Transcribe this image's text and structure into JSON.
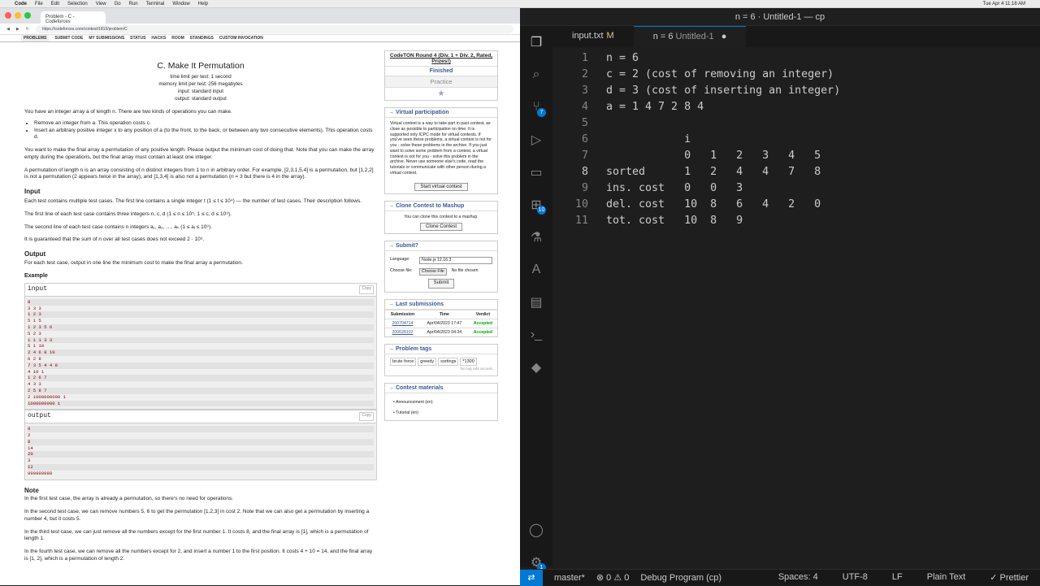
{
  "mac": {
    "app": "Code",
    "menus": [
      "File",
      "Edit",
      "Selection",
      "View",
      "Go",
      "Run",
      "Terminal",
      "Window",
      "Help"
    ],
    "clock": "Tue Apr 4 11:18 AM"
  },
  "browser": {
    "tab": "Problem - C - Codeforces",
    "url": "https://codeforces.com/contest/1810/problem/C",
    "nav": [
      "PROBLEMS",
      "SUBMIT CODE",
      "MY SUBMISSIONS",
      "STATUS",
      "HACKS",
      "ROOM",
      "STANDINGS",
      "CUSTOM INVOCATION"
    ]
  },
  "problem": {
    "title": "C. Make It Permutation",
    "limits": [
      "time limit per test: 1 second",
      "memory limit per test: 256 megabytes",
      "input: standard input",
      "output: standard output"
    ],
    "p1": "You have an integer array a of length n. There are two kinds of operations you can make.",
    "b1": "Remove an integer from a. This operation costs c.",
    "b2": "Insert an arbitrary positive integer x to any position of a (to the front, to the back, or between any two consecutive elements). This operation costs d.",
    "p2": "You want to make the final array a permutation of any positive length. Please output the minimum cost of doing that. Note that you can make the array empty during the operations, but the final array must contain at least one integer.",
    "p3": "A permutation of length n is an array consisting of n distinct integers from 1 to n in arbitrary order. For example, [2,3,1,5,4] is a permutation, but [1,2,2] is not a permutation (2 appears twice in the array), and [1,3,4] is also not a permutation (n = 3 but there is 4 in the array).",
    "h_input": "Input",
    "in1": "Each test contains multiple test cases. The first line contains a single integer t (1 ≤ t ≤ 10⁴) — the number of test cases. Their description follows.",
    "in2": "The first line of each test case contains three integers n, c, d (1 ≤ n ≤ 10⁵, 1 ≤ c, d ≤ 10⁹).",
    "in3": "The second line of each test case contains n integers a₁, a₂, …, aₙ (1 ≤ aᵢ ≤ 10⁹).",
    "in4": "It is guaranteed that the sum of n over all test cases does not exceed 2 · 10⁵.",
    "h_output": "Output",
    "out1": "For each test case, output in one line the minimum cost to make the final array a permutation.",
    "h_example": "Example",
    "ex_in": "input",
    "ex_out": "output",
    "copy": "Copy",
    "input_lines": [
      "8",
      "3 3 3",
      "1 2 3",
      "5 1 5",
      "1 2 3 5 6",
      "5 2 3",
      "1 1 1 3 3",
      "5 1 10",
      "2 4 6 8 10",
      "6 2 8",
      "7 3 5 4 4 8",
      "4 10 1",
      "1 2 6 7",
      "4 3 3",
      "2 5 8 7",
      "2 1000000000 1",
      "1000000000 1"
    ],
    "output_lines": [
      "0",
      "2",
      "8",
      "14",
      "20",
      "3",
      "12",
      "999999998"
    ],
    "h_note": "Note",
    "n1": "In the first test case, the array is already a permutation, so there's no need for operations.",
    "n2": "In the second test case, we can remove numbers 5, 6 to get the permutation [1,2,3] in cost 2. Note that we can also get a permutation by inserting a number 4, but it costs 5.",
    "n3": "In the third test case, we can just remove all the numbers except for the first number 1. It costs 8, and the final array is [1], which is a permutation of length 1.",
    "n4": "In the fourth test case, we can remove all the numbers except for 2, and insert a number 1 to the first position. It costs 4 + 10 = 14, and the final array is [1, 2], which is a permutation of length 2."
  },
  "side": {
    "round": "CodeTON Round 4 (Div. 1 + Div. 2, Rated, Prizes!)",
    "finished": "Finished",
    "practice": "Practice",
    "vp_h": "→ Virtual participation",
    "vp_text": "Virtual contest is a way to take part in past contest, as close as possible to participation on time. It is supported only ICPC mode for virtual contests. If you've seen these problems, a virtual contest is not for you - solve these problems in the archive. If you just want to solve some problem from a contest, a virtual contest is not for you - solve this problem in the archive. Never use someone else's code, read the tutorials or communicate with other person during a virtual contest.",
    "vp_btn": "Start virtual contest",
    "clone_h": "→ Clone Contest to Mashup",
    "clone_text": "You can clone this contest to a mashup.",
    "clone_btn": "Clone Contest",
    "submit_h": "→ Submit?",
    "lang_label": "Language:",
    "lang": "Node.js 12.16.3",
    "file_label": "Choose file:",
    "choose": "Choose File",
    "nofile": "No file chosen",
    "submit_btn": "Submit",
    "last_h": "→ Last submissions",
    "cols": [
      "Submission",
      "Time",
      "Verdict"
    ],
    "rows": [
      [
        "200704714",
        "Apr/04/2023 17:47",
        "Accepted"
      ],
      [
        "200628102",
        "Apr/04/2023 04:34",
        "Accepted"
      ]
    ],
    "tags_h": "→ Problem tags",
    "tags": [
      "brute force",
      "greedy",
      "sortings",
      "*1300"
    ],
    "notag": "No tag edit access",
    "mat_h": "→ Contest materials",
    "mat": [
      "Announcement (en)",
      "Tutorial (en)"
    ]
  },
  "vscode": {
    "title": "n = 6 · Untitled-1 — cp",
    "tab1": "input.txt",
    "tab1_mod": "M",
    "tab2": "n = 6",
    "tab2_sub": "Untitled-1",
    "lines": [
      "n = 6",
      "c = 2 (cost of removing an integer)",
      "d = 3 (cost of inserting an integer)",
      "a = 1 4 7 2 8 4",
      "",
      "            i",
      "            0   1   2   3   4   5",
      "sorted      1   2   4   4   7   8",
      "ins. cost   0   0   3",
      "del. cost   10  8   6   4   2   0",
      "tot. cost   10  8   9"
    ],
    "badges": [
      "7",
      "10",
      "1"
    ],
    "status": {
      "branch": "master*",
      "problems": "⊗ 0 ⚠ 0",
      "debug": "Debug Program (cp)",
      "spaces": "Spaces: 4",
      "enc": "UTF-8",
      "eol": "LF",
      "lang": "Plain Text",
      "prettier": "✓ Prettier"
    }
  },
  "colors": {
    "accent": "#0078d4",
    "cf_link": "#3b5998",
    "accepted": "#0a0"
  }
}
